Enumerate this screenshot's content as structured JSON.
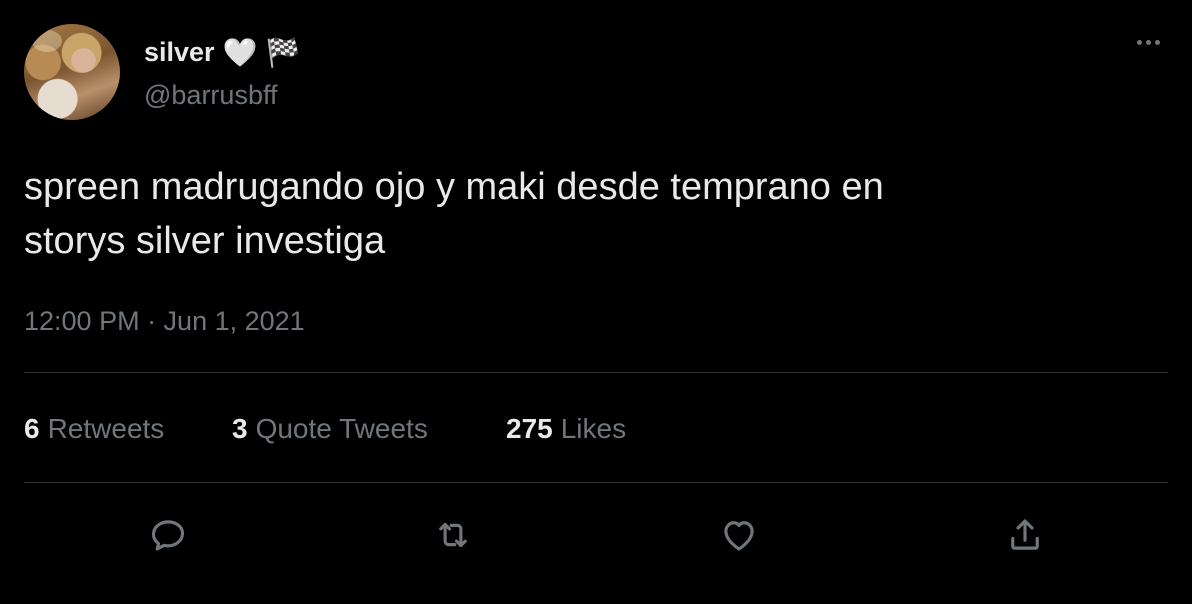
{
  "tweet": {
    "author": {
      "display_name": "silver",
      "name_emojis": [
        "🤍",
        "🏁"
      ],
      "handle": "@barrusbff",
      "avatar_icon": "avatar"
    },
    "text_lines": [
      "spreen madrugando ojo y maki desde temprano en",
      "storys silver investiga"
    ],
    "timestamp": "12:00 PM · Jun 1, 2021",
    "stats": {
      "retweets": {
        "count": "6",
        "label": "Retweets"
      },
      "quote_tweets": {
        "count": "3",
        "label": "Quote Tweets"
      },
      "likes": {
        "count": "275",
        "label": "Likes"
      }
    },
    "actions": [
      "reply-icon",
      "retweet-icon",
      "like-icon",
      "share-icon"
    ],
    "more_icon": "more-icon"
  },
  "colors": {
    "background": "#000000",
    "primary_text": "#e7e9ea",
    "secondary_text": "#71767b",
    "divider": "#2f3336"
  }
}
